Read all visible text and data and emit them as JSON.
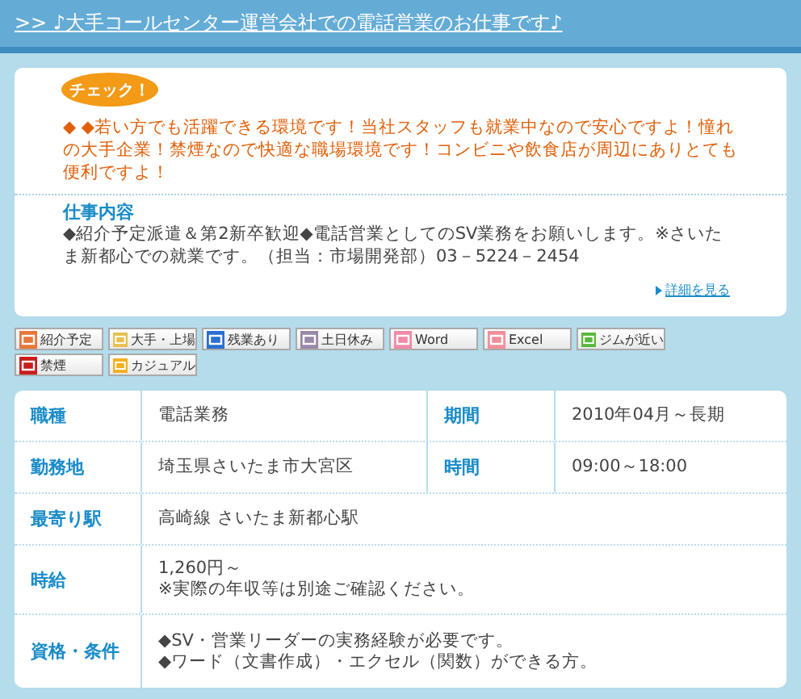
{
  "header": {
    "title": ">> ♪大手コールセンター運営会社での電話営業のお仕事です♪"
  },
  "check": {
    "badge": "チェック！",
    "text": "◆ ◆若い方でも活躍できる環境です！当社スタッフも就業中なので安心ですよ！憧れの大手企業！禁煙なので快適な職場環境です！コンビニや飲食店が周辺にありとても便利ですよ！"
  },
  "job": {
    "heading": "仕事内容",
    "text": "◆紹介予定派遣＆第2新卒歓迎◆電話営業としてのSV業務をお願いします。※さいたま新都心での就業です。（担当：市場開発部）03－5224－2454",
    "link": "詳細を見る"
  },
  "tags": [
    {
      "label": "紹介予定",
      "color": "#e8763a"
    },
    {
      "label": "大手・上場",
      "color": "#e8c050"
    },
    {
      "label": "残業あり",
      "color": "#2a6fd0"
    },
    {
      "label": "土日休み",
      "color": "#9a88a8"
    },
    {
      "label": "Word",
      "color": "#f08aa8"
    },
    {
      "label": "Excel",
      "color": "#f0909a"
    },
    {
      "label": "ジムが近い",
      "color": "#5ab83a"
    },
    {
      "label": "禁煙",
      "color": "#c81e1e"
    },
    {
      "label": "カジュアル",
      "color": "#f5b020"
    }
  ],
  "table": {
    "rows": [
      {
        "cells": [
          {
            "label": "職種",
            "value": "電話業務"
          },
          {
            "label": "期間",
            "value": "2010年04月～長期"
          }
        ]
      },
      {
        "cells": [
          {
            "label": "勤務地",
            "value": "埼玉県さいたま市大宮区"
          },
          {
            "label": "時間",
            "value": "09:00～18:00"
          }
        ]
      },
      {
        "cells": [
          {
            "label": "最寄り駅",
            "value": "高崎線 さいたま新都心駅"
          }
        ]
      },
      {
        "cells": [
          {
            "label": "時給",
            "value": "1,260円～\n※実際の年収等は別途ご確認ください。"
          }
        ]
      },
      {
        "cells": [
          {
            "label": "資格・条件",
            "value": "◆SV・営業リーダーの実務経験が必要です。\n◆ワード（文書作成）・エクセル（関数）ができる方。"
          }
        ]
      }
    ]
  }
}
